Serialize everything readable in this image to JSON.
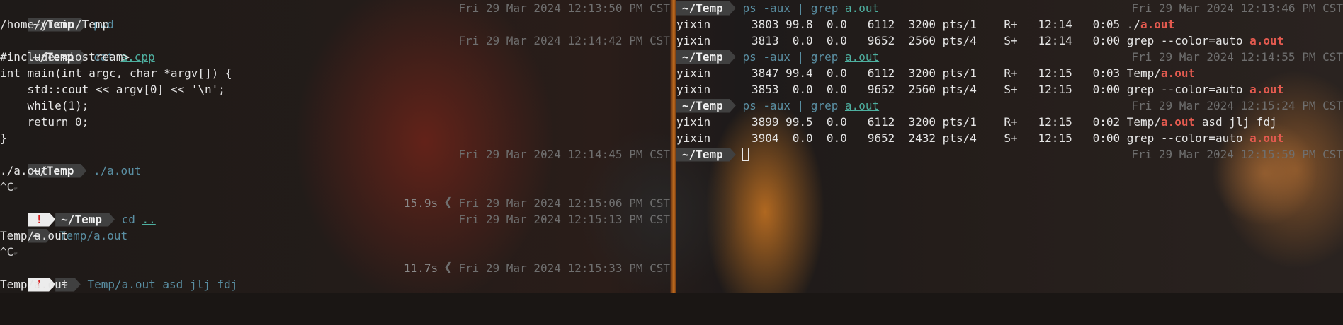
{
  "left": {
    "prompt1": {
      "path": "~/Temp",
      "command": "pwd",
      "time": "Fri 29 Mar 2024 12:13:50 PM CST"
    },
    "out1": "/home/yixin/Temp",
    "prompt2": {
      "path": "~/Temp",
      "command": "cat",
      "arg": "a.cpp",
      "time": "Fri 29 Mar 2024 12:14:42 PM CST"
    },
    "code": [
      "#include <iostream>",
      "int main(int argc, char *argv[]) {",
      "    std::cout << argv[0] << '\\n';",
      "    while(1);",
      "    return 0;",
      "}"
    ],
    "prompt3": {
      "path": "~/Temp",
      "command": "./a.out",
      "time": "Fri 29 Mar 2024 12:14:45 PM CST"
    },
    "out3": "./a.out",
    "ctrlc": "^C",
    "return_glyph": "⏎",
    "prompt4": {
      "error": "!",
      "path": "~/Temp",
      "command": "cd",
      "arg": "..",
      "duration": "15.9s",
      "time": "Fri 29 Mar 2024 12:15:06 PM CST"
    },
    "prompt5": {
      "path": "~",
      "command": "Temp/a.out",
      "time": "Fri 29 Mar 2024 12:15:13 PM CST"
    },
    "out5": "Temp/a.out",
    "prompt6": {
      "error": "!",
      "path": "~",
      "command": "Temp/a.out asd jlj fdj",
      "duration": "11.7s",
      "time": "Fri 29 Mar 2024 12:15:33 PM CST"
    },
    "out6": "Temp/a.out"
  },
  "right": {
    "cmd_ps": "ps -aux",
    "pipe": "|",
    "cmd_grep": "grep",
    "grep_arg": "a.out",
    "blocks": [
      {
        "path": "~/Temp",
        "time": "Fri 29 Mar 2024 12:13:46 PM CST",
        "rows": [
          {
            "cols": "yixin      3803 99.8  0.0   6112  3200 pts/1    R+   12:14   0:05 ",
            "pre": "./",
            "hl": "a.out",
            "post": ""
          },
          {
            "cols": "yixin      3813  0.0  0.0   9652  2560 pts/4    S+   12:14   0:00 ",
            "pre": "grep --color=auto ",
            "hl": "a.out",
            "post": ""
          }
        ]
      },
      {
        "path": "~/Temp",
        "time": "Fri 29 Mar 2024 12:14:55 PM CST",
        "rows": [
          {
            "cols": "yixin      3847 99.4  0.0   6112  3200 pts/1    R+   12:15   0:03 ",
            "pre": "Temp/",
            "hl": "a.out",
            "post": ""
          },
          {
            "cols": "yixin      3853  0.0  0.0   9652  2560 pts/4    S+   12:15   0:00 ",
            "pre": "grep --color=auto ",
            "hl": "a.out",
            "post": ""
          }
        ]
      },
      {
        "path": "~/Temp",
        "time": "Fri 29 Mar 2024 12:15:24 PM CST",
        "rows": [
          {
            "cols": "yixin      3899 99.5  0.0   6112  3200 pts/1    R+   12:15   0:02 ",
            "pre": "Temp/",
            "hl": "a.out",
            "post": " asd jlj fdj"
          },
          {
            "cols": "yixin      3904  0.0  0.0   9652  2432 pts/4    S+   12:15   0:00 ",
            "pre": "grep --color=auto ",
            "hl": "a.out",
            "post": ""
          }
        ]
      }
    ],
    "final_prompt": {
      "path": "~/Temp",
      "time": "Fri 29 Mar 2024 12:15:59 PM CST"
    }
  },
  "colors": {
    "command": "#5a8fa3",
    "highlight": "#e35a4f",
    "segment": "#404040",
    "error_fg": "#d71e1e",
    "timestamp": "#6f6f6f"
  },
  "icons": {
    "duration_separator": "chevron-left-icon",
    "cursor": "block-cursor-icon",
    "return": "return-icon"
  }
}
